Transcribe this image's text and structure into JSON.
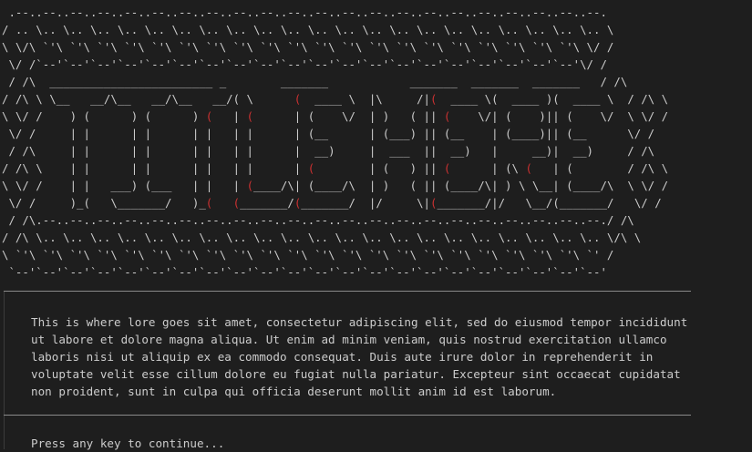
{
  "colors": {
    "background": "#1e1e1e",
    "text": "#cccccc",
    "accent_red": "#cd3131",
    "rule": "#8a8a8a"
  },
  "banner": {
    "lines": [
      [
        {
          "t": " .--..--..--..--..--..--..--..--..--..--..--..--..--..--..--..--..--..--..--..--..--..--. "
        }
      ],
      [
        {
          "t": "/ .. \\.. \\.. \\.. \\.. \\.. \\.. \\.. \\.. \\.. \\.. \\.. \\.. \\.. \\.. \\.. \\.. \\.. \\.. \\.. \\.. \\.. \\"
        }
      ],
      [
        {
          "t": "\\ \\/\\ `'\\ `'\\ `'\\ `'\\ `'\\ `'\\ `'\\ `'\\ `'\\ `'\\ `'\\ `'\\ `'\\ `'\\ `'\\ `'\\ `'\\ `'\\ `'\\ `'\\ \\/ /"
        }
      ],
      [
        {
          "t": " \\/ /`--'`--'`--'`--'`--'`--'`--'`--'`--'`--'`--'`--'`--'`--'`--'`--'`--'`--'`--'`--'\\/ / "
        }
      ],
      [
        {
          "t": " / /\\  ________________________ _        _______            _______  _______  _______   / /\\ "
        }
      ],
      [
        {
          "t": "/ /\\ \\ \\__   __/\\__   __/\\__   __/( \\      "
        },
        {
          "t": "(",
          "r": true
        },
        {
          "t": "  ____ \\  |\\     /|"
        },
        {
          "t": "(",
          "r": true
        },
        {
          "t": "  ____ \\(  ____ )(  ____ \\  / /\\ \\"
        }
      ],
      [
        {
          "t": "\\ \\/ /    ) (      ) (      ) "
        },
        {
          "t": "(",
          "r": true
        },
        {
          "t": "   | "
        },
        {
          "t": "(",
          "r": true
        },
        {
          "t": "      | (    \\/  | )   ( || "
        },
        {
          "t": "(",
          "r": true
        },
        {
          "t": "    \\/| (    )|| (    \\/  \\ \\/ /"
        }
      ],
      [
        {
          "t": " \\/ /     | |      | |      | |   | |      | (__      | (___) || (__    | (____)|| (__      \\/ / "
        }
      ],
      [
        {
          "t": " / /\\     | |      | |      | |   | |      |  __)     |  ___  ||  __)   |     __)|  __)     / /\\ "
        }
      ],
      [
        {
          "t": "/ /\\ \\    | |      | |      | |   | |      | "
        },
        {
          "t": "(",
          "r": true
        },
        {
          "t": "        | (   ) || "
        },
        {
          "t": "(",
          "r": true
        },
        {
          "t": "      | (\\ "
        },
        {
          "t": "(",
          "r": true
        },
        {
          "t": "   | (        / /\\ \\"
        }
      ],
      [
        {
          "t": "\\ \\/ /    | |   ___) (___   | |   | "
        },
        {
          "t": "(",
          "r": true
        },
        {
          "t": "____/\\| (____/\\  | )   ( || (____/\\| ) \\ \\__| (____/\\  \\ \\/ /"
        }
      ],
      [
        {
          "t": " \\/ /     )_(   \\_______/   )_"
        },
        {
          "t": "(",
          "r": true
        },
        {
          "t": "   "
        },
        {
          "t": "(",
          "r": true
        },
        {
          "t": "_______/"
        },
        {
          "t": "(",
          "r": true
        },
        {
          "t": "_______/  |/     \\|"
        },
        {
          "t": "(",
          "r": true
        },
        {
          "t": "_______/|/   \\__/(_______/   \\/ / "
        }
      ],
      [
        {
          "t": " / /\\.--..--..--..--..--..--..--..--..--..--..--..--..--..--..--..--..--..--..--..--..--./ /\\ "
        }
      ],
      [
        {
          "t": "/ /\\ \\.. \\.. \\.. \\.. \\.. \\.. \\.. \\.. \\.. \\.. \\.. \\.. \\.. \\.. \\.. \\.. \\.. \\.. \\.. \\.. \\.. \\/\\ \\"
        }
      ],
      [
        {
          "t": "\\ `'\\ `'\\ `'\\ `'\\ `'\\ `'\\ `'\\ `'\\ `'\\ `'\\ `'\\ `'\\ `'\\ `'\\ `'\\ `'\\ `'\\ `'\\ `'\\ `'\\ `'\\ `' /"
        }
      ],
      [
        {
          "t": " `--'`--'`--'`--'`--'`--'`--'`--'`--'`--'`--'`--'`--'`--'`--'`--'`--'`--'`--'`--'`--'`--' "
        }
      ]
    ]
  },
  "lore": {
    "lines": [
      "This is where lore goes sit amet, consectetur adipiscing elit, sed do eiusmod tempor incididunt",
      "ut labore et dolore magna aliqua. Ut enim ad minim veniam, quis nostrud exercitation ullamco",
      "laboris nisi ut aliquip ex ea commodo consequat. Duis aute irure dolor in reprehenderit in",
      "voluptate velit esse cillum dolore eu fugiat nulla pariatur. Excepteur sint occaecat cupidatat",
      "non proident, sunt in culpa qui officia deserunt mollit anim id est laborum."
    ]
  },
  "prompt": {
    "text": "Press any key to continue..."
  }
}
